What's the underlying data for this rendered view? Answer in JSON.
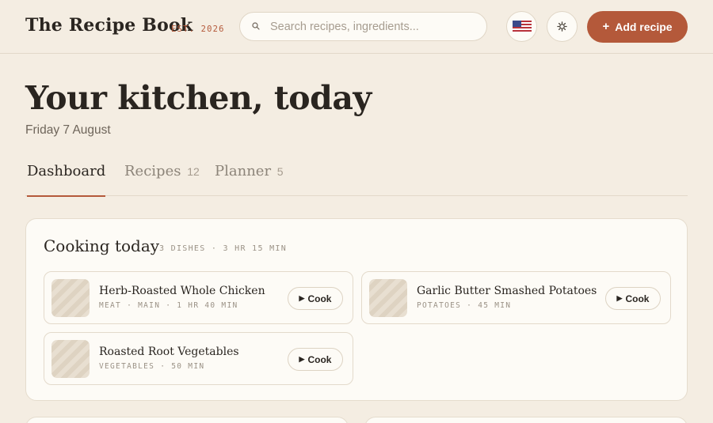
{
  "header": {
    "brand": "The Recipe Book",
    "est": "EST. 2026",
    "search_placeholder": "Search recipes, ingredients...",
    "search_icon": "search-icon",
    "flag_icon": "us-flag-icon",
    "settings_icon": "gear-icon",
    "add_label": "Add recipe",
    "add_icon": "+"
  },
  "page": {
    "title": "Your kitchen, today",
    "date": "Friday 7 August"
  },
  "tabs": [
    {
      "label": "Dashboard",
      "count": ""
    },
    {
      "label": "Recipes",
      "count": "12"
    },
    {
      "label": "Planner",
      "count": "5"
    }
  ],
  "cooking_today": {
    "title": "Cooking today",
    "meta": "3 DISHES · 3 HR 15 MIN",
    "dishes": [
      {
        "name": "Herb-Roasted Whole Chicken",
        "meta": "MEAT · MAIN · 1 HR 40 MIN",
        "action": "Cook"
      },
      {
        "name": "Garlic Butter Smashed Potatoes",
        "meta": "POTATOES · 45 MIN",
        "action": "Cook"
      },
      {
        "name": "Roasted Root Vegetables",
        "meta": "VEGETABLES · 50 MIN",
        "action": "Cook"
      }
    ]
  },
  "colors": {
    "accent": "#b4593a",
    "background": "#f4ede2",
    "card": "#fdfbf6"
  }
}
